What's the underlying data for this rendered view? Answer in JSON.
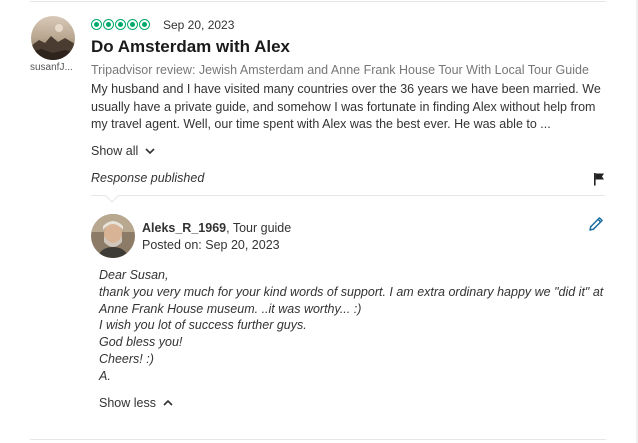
{
  "review": {
    "username": "susanfJ...",
    "rating": 5,
    "date": "Sep 20, 2023",
    "title": "Do Amsterdam with Alex",
    "subtitle": "Tripadvisor review: Jewish Amsterdam and Anne Frank House Tour With Local Tour Guide",
    "body": "My husband and I have visited many countries over the 36 years we have been married. We usually have a private guide, and somehow I was fortunate in finding Alex without help from my travel agent. Well, our time spent with Alex was the best ever. He was able to ...",
    "show_all_label": "Show all",
    "response_status": "Response published"
  },
  "response": {
    "owner_name": "Aleks_R_1969",
    "owner_role": ", Tour guide",
    "posted_label": "Posted on: Sep 20, 2023",
    "lines": [
      "Dear Susan,",
      "thank you very much for your kind words of support. I am extra ordinary happy we \"did it\" at Anne Frank House museum. ..it was worthy... :)",
      "I wish you lot of success further guys.",
      "God bless you!",
      "Cheers! :)",
      "A."
    ],
    "show_less_label": "Show less"
  },
  "icons": {
    "rating": "rating-bubbles-icon",
    "show_all": "chevron-down-icon",
    "flag": "flag-icon",
    "edit": "pencil-icon",
    "show_less": "chevron-up-icon"
  },
  "colors": {
    "rating_green": "#00aa6c",
    "edit_blue": "#1a6fa0"
  }
}
